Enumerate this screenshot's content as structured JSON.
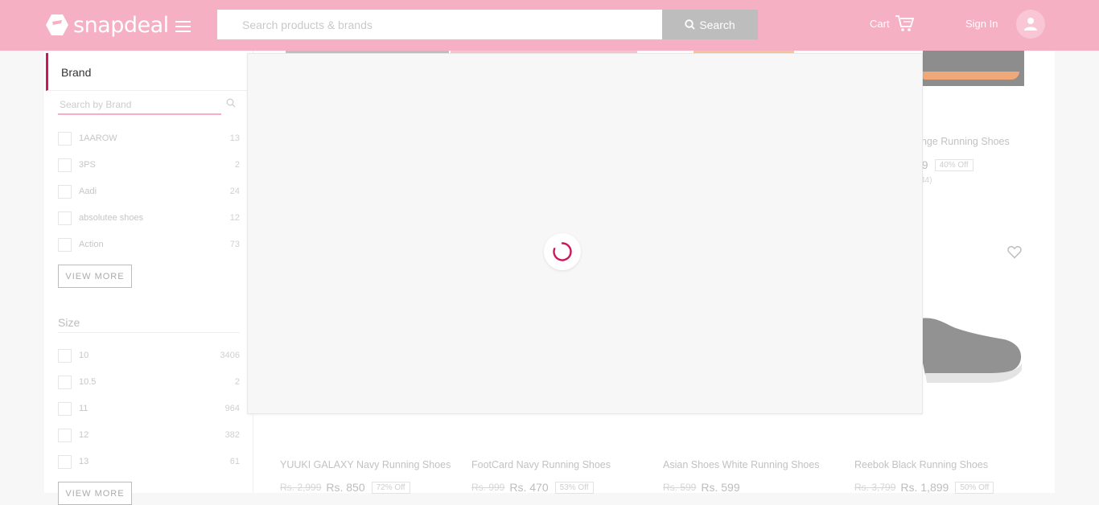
{
  "header": {
    "logo_text": "snapdeal",
    "search_placeholder": "Search products & brands",
    "search_button": "Search",
    "cart_label": "Cart",
    "signin_label": "Sign In"
  },
  "filters": {
    "brand": {
      "title": "Brand",
      "search_placeholder": "Search by Brand",
      "items": [
        {
          "label": "1AAROW",
          "count": "13"
        },
        {
          "label": "3PS",
          "count": "2"
        },
        {
          "label": "Aadi",
          "count": "24"
        },
        {
          "label": "absolutee shoes",
          "count": "12"
        },
        {
          "label": "Action",
          "count": "73"
        }
      ],
      "view_more": "VIEW MORE"
    },
    "size": {
      "title": "Size",
      "items": [
        {
          "label": "10",
          "count": "3406"
        },
        {
          "label": "10.5",
          "count": "2"
        },
        {
          "label": "11",
          "count": "964"
        },
        {
          "label": "12",
          "count": "382"
        },
        {
          "label": "13",
          "count": "61"
        }
      ],
      "view_more": "VIEW MORE"
    }
  },
  "products_top": {
    "title_fragment": "ange Running Shoes",
    "price_fragment": "99",
    "off": "40% Off",
    "rating_fragment": "44)"
  },
  "products": [
    {
      "title": "YUUKI GALAXY Navy Running Shoes",
      "old": "Rs. 2,999",
      "new": "Rs. 850",
      "off": "72% Off"
    },
    {
      "title": "FootCard Navy Running Shoes",
      "old": "Rs. 999",
      "new": "Rs. 470",
      "off": "53% Off"
    },
    {
      "title": "Asian Shoes White Running Shoes",
      "old": "Rs. 599",
      "new": "Rs. 599",
      "off": ""
    },
    {
      "title": "Reebok Black Running Shoes",
      "old": "Rs. 3,799",
      "new": "Rs. 1,899",
      "off": "50% Off"
    }
  ],
  "colors": {
    "header_bg": "#f5b0c3",
    "accent": "#c9195c",
    "overlay_bg": "#f7f7f7"
  }
}
